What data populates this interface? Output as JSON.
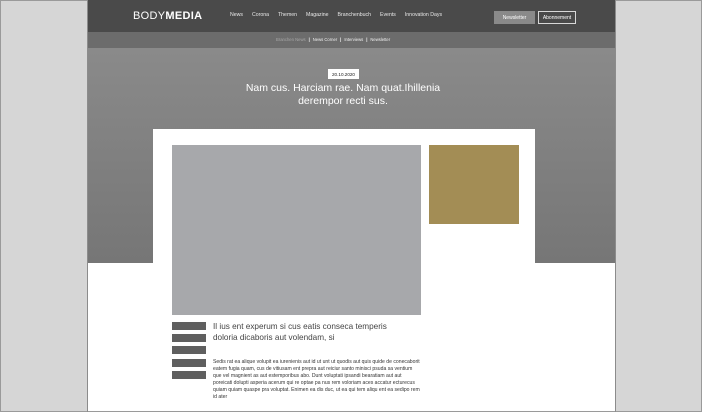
{
  "logo": {
    "part1": "BODY",
    "part2": "MEDIA"
  },
  "nav": {
    "items": [
      "News",
      "Corona",
      "Themen",
      "Magazine",
      "Branchenbuch",
      "Events",
      "Innovation Days"
    ],
    "newsletter_button": "Newsletter",
    "abo_button": "Abonnement"
  },
  "subnav": {
    "items": [
      "Branchen News",
      "News Corner",
      "Interviews",
      "Newsletter"
    ],
    "separator": "|"
  },
  "hero": {
    "date": "20.10.2020",
    "title_line1": "Nam cus. Harciam rae. Nam quat.Ihillenia",
    "title_line2": "derempor recti sus."
  },
  "article": {
    "headline": "Il ius ent experum si cus eatis conseca temperis doloria dicaboris aut volendam, si",
    "body": "Sedis rat ea alique volupit ea iurenienis aut id ut unt ut quodis aut quis quide de conecaborit eatem fugia quam, cus de vitiusam ent prepra aut reiciur santo minisci psuda sa ventium que vel magnient as aut estemporibus abo. Dunt voluptati ipsandi bearatiam aut aut poreicati dolupti asperia acerum qui re optae pa nus rem voloriam aces accatur ecturecus quiam quiam quaspe pra voluptat. Enimen ea dis duc, ut ea qui tem aliqu ent ea sedipo rem id ater"
  },
  "colors": {
    "topbar": "#4a4a4a",
    "subbar": "#6c6c6c",
    "hero": "#808080",
    "main_image": "#a7a8ab",
    "side_image": "#a38d55"
  }
}
